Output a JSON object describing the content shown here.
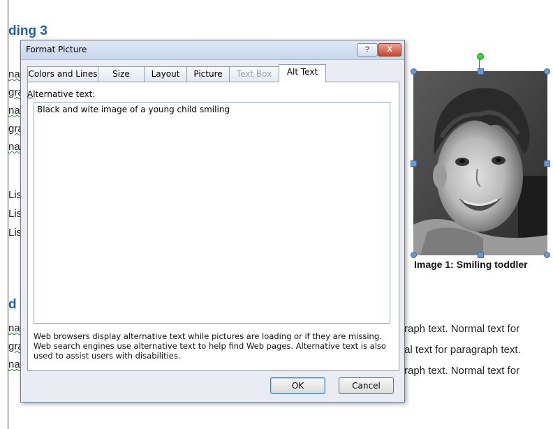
{
  "document": {
    "heading3_fragment": "ding 3",
    "heading_bottom_fragment": "d",
    "left_fragments": [
      "nal",
      "gra",
      "nal",
      "gra",
      "nal",
      "Lis",
      "Lis",
      "Lis",
      "nal",
      "gra",
      "nal"
    ],
    "right_lines": [
      "raph text. Normal text for",
      "al text for paragraph text.",
      "raph text. Normal text for"
    ],
    "caption": "Image 1: Smiling toddler"
  },
  "dialog": {
    "title": "Format Picture",
    "help_glyph": "?",
    "close_glyph": "X",
    "tabs": [
      {
        "label": "Colors and Lines",
        "state": "normal"
      },
      {
        "label": "Size",
        "state": "normal"
      },
      {
        "label": "Layout",
        "state": "normal"
      },
      {
        "label": "Picture",
        "state": "normal"
      },
      {
        "label": "Text Box",
        "state": "disabled"
      },
      {
        "label": "Alt Text",
        "state": "active"
      }
    ],
    "alt_label_mnemonic": "A",
    "alt_label_rest": "lternative text:",
    "alt_text_value": "Black and wite image of a young child smiling",
    "help_text": "Web browsers display alternative text while pictures are loading or if they are missing.  Web search engines use alternative text to help find Web pages.  Alternative text is also used to assist users with disabilities.",
    "ok_label": "OK",
    "cancel_label": "Cancel"
  },
  "colors": {
    "heading": "#1f5fa7",
    "dialog_bg": "#e9edf3",
    "close_button": "#c4452d",
    "selection_handle": "#6d97cf",
    "rotation_handle": "#3bd23b"
  }
}
